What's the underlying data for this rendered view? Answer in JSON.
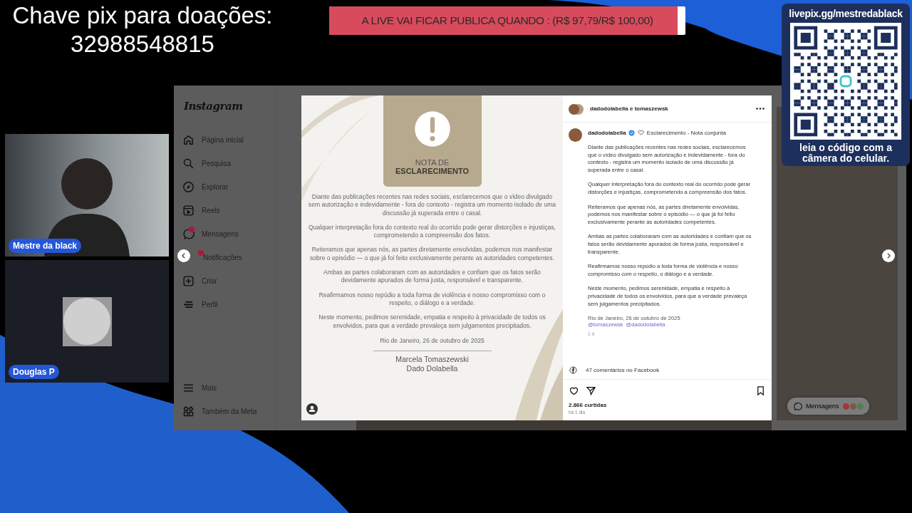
{
  "donation": {
    "title": "Chave pix para doações:",
    "pix_key": "32988548815"
  },
  "goal_banner": {
    "text": "A LIVE VAI FICAR PUBLICA QUANDO : (R$ 97,79/R$ 100,00)",
    "level": 0.978
  },
  "qr_card": {
    "url": "livepix.gg/mestredablack",
    "caption": "leia o código com a câmera do celular."
  },
  "participants": [
    {
      "name": "Mestre da black",
      "kind": "camera"
    },
    {
      "name": "Douglas P",
      "kind": "avatar"
    }
  ],
  "instagram": {
    "logo": "Instagram",
    "nav": [
      {
        "label": "Página inicial",
        "badge": false
      },
      {
        "label": "Pesquisa",
        "badge": false
      },
      {
        "label": "Explorar",
        "badge": false
      },
      {
        "label": "Reels",
        "badge": false
      },
      {
        "label": "Mensagens",
        "badge": true
      },
      {
        "label": "Notificações",
        "badge": true
      },
      {
        "label": "Criar",
        "badge": false
      },
      {
        "label": "Perfil",
        "badge": false
      }
    ],
    "nav_bottom": [
      {
        "label": "Mais",
        "badge": false
      },
      {
        "label": "Também da Meta",
        "badge": false
      }
    ],
    "note_image": {
      "heading": "NOTA DE",
      "heading_strong": "ESCLARECIMENTO",
      "paragraphs": [
        "Diante das publicações recentes nas redes sociais, esclarecemos que o vídeo divulgado sem autorização e indevidamente - fora do contexto - registra um momento isolado de uma discussão já superada entre o casal.",
        "Qualquer interpretação fora do contexto real do ocorrido pode gerar distorções e injustiças, comprometendo a compreensão dos fatos.",
        "Reiteramos que apenas nós, as partes diretamente envolvidas, podemos nos manifestar sobre o episódio — o que já foi feito exclusivamente perante as autoridades competentes.",
        "Ambas as partes colaboraram com as autoridades e confiam que os fatos serão devidamente apurados de forma justa, responsável e transparente.",
        "Reafirmamos nosso repúdio a toda forma de violência e nosso compromisso com o respeito, o diálogo e a verdade.",
        "Neste momento, pedimos serenidade, empatia e respeito à privacidade de todos os envolvidos, para que a verdade prevaleça sem julgamentos precipitados."
      ],
      "date": "Rio de Janeiro, 26 de outubro de 2025",
      "signatures": [
        "Marcela Tomaszewski",
        "Dado Dolabella"
      ]
    },
    "post": {
      "header": "dadodolabella e tomaszewsk",
      "author": "dadodolabella",
      "verified": true,
      "caption_title": "Esclarecimento - Nota conjunta",
      "paragraphs": [
        "Diante das publicações recentes nas redes sociais, esclarecemos que o vídeo divulgado sem autorização e indevidamente - fora do contexto - registra um momento isolado de uma discussão já superada entre o casal.",
        "Qualquer interpretação fora do contexto real do ocorrido pode gerar distorções e injustiças, comprometendo a compreensão dos fatos.",
        "Reiteramos que apenas nós, as partes diretamente envolvidas, podemos nos manifestar sobre o episódio — o que já foi feito exclusivamente perante as autoridades competentes.",
        "Ambas as partes colaboraram com as autoridades e confiam que os fatos serão devidamente apurados de forma justa, responsável e transparente.",
        "Reafirmamos nosso repúdio a toda forma de violência e nosso compromisso com o respeito, o diálogo e a verdade.",
        "Neste momento, pedimos serenidade, empatia e respeito à privacidade de todos os envolvidos, para que a verdade prevaleça sem julgamentos precipitados."
      ],
      "date": "Rio de Janeiro, 26 de outubro de 2025",
      "mentions": [
        "@tomaszewsk",
        "@dadodolabella"
      ],
      "age": "1 d",
      "comments": "47 comentários no Facebook",
      "likes": "2.866 curtidas",
      "time": "há 1 dia"
    },
    "messages_pill": {
      "label": "Mensagens"
    }
  }
}
